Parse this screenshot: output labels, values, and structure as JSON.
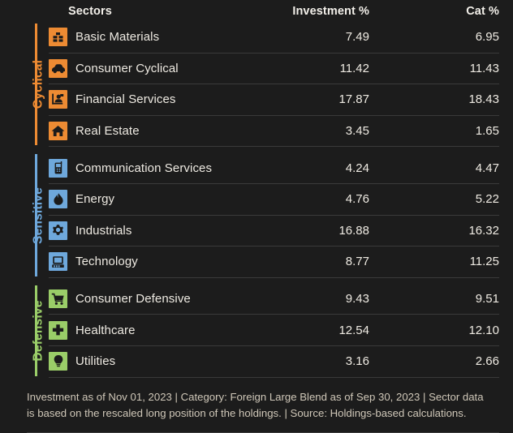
{
  "theme": {
    "background": "#1c1c1c",
    "divider": "#3a3a3a",
    "text": "#eeeae2",
    "footnote_text": "#cfc7b8"
  },
  "header": {
    "sectors_label": "Sectors",
    "investment_label": "Investment  %",
    "cat_label": "Cat  %"
  },
  "groups": [
    {
      "label": "Cyclical",
      "color": "#ED8B33",
      "rows": [
        {
          "icon": "basic-materials-icon",
          "sector": "Basic Materials",
          "investment": "7.49",
          "cat": "6.95"
        },
        {
          "icon": "consumer-cyclical-icon",
          "sector": "Consumer Cyclical",
          "investment": "11.42",
          "cat": "11.43"
        },
        {
          "icon": "financial-services-icon",
          "sector": "Financial Services",
          "investment": "17.87",
          "cat": "18.43"
        },
        {
          "icon": "real-estate-icon",
          "sector": "Real Estate",
          "investment": "3.45",
          "cat": "1.65"
        }
      ]
    },
    {
      "label": "Sensitive",
      "color": "#6EA8DC",
      "rows": [
        {
          "icon": "communication-services-icon",
          "sector": "Communication Services",
          "investment": "4.24",
          "cat": "4.47"
        },
        {
          "icon": "energy-icon",
          "sector": "Energy",
          "investment": "4.76",
          "cat": "5.22"
        },
        {
          "icon": "industrials-icon",
          "sector": "Industrials",
          "investment": "16.88",
          "cat": "16.32"
        },
        {
          "icon": "technology-icon",
          "sector": "Technology",
          "investment": "8.77",
          "cat": "11.25"
        }
      ]
    },
    {
      "label": "Defensive",
      "color": "#9ACD68",
      "rows": [
        {
          "icon": "consumer-defensive-icon",
          "sector": "Consumer Defensive",
          "investment": "9.43",
          "cat": "9.51"
        },
        {
          "icon": "healthcare-icon",
          "sector": "Healthcare",
          "investment": "12.54",
          "cat": "12.10"
        },
        {
          "icon": "utilities-icon",
          "sector": "Utilities",
          "investment": "3.16",
          "cat": "2.66"
        }
      ]
    }
  ],
  "footnote": "Investment as of Nov 01, 2023 | Category: Foreign Large Blend as of Sep 30, 2023 | Sector data is based on the rescaled long position of the holdings. | Source: Holdings-based calculations.",
  "chart_data": {
    "type": "table",
    "title": "Sector Exposure",
    "columns": [
      "Sectors",
      "Investment  %",
      "Cat  %"
    ],
    "groups": [
      "Cyclical",
      "Sensitive",
      "Defensive"
    ],
    "categories": [
      "Basic Materials",
      "Consumer Cyclical",
      "Financial Services",
      "Real Estate",
      "Communication Services",
      "Energy",
      "Industrials",
      "Technology",
      "Consumer Defensive",
      "Healthcare",
      "Utilities"
    ],
    "series": [
      {
        "name": "Investment  %",
        "values": [
          7.49,
          11.42,
          17.87,
          3.45,
          4.24,
          4.76,
          16.88,
          8.77,
          9.43,
          12.54,
          3.16
        ]
      },
      {
        "name": "Cat  %",
        "values": [
          6.95,
          11.43,
          18.43,
          1.65,
          4.47,
          5.22,
          16.32,
          11.25,
          9.51,
          12.1,
          2.66
        ]
      }
    ]
  }
}
